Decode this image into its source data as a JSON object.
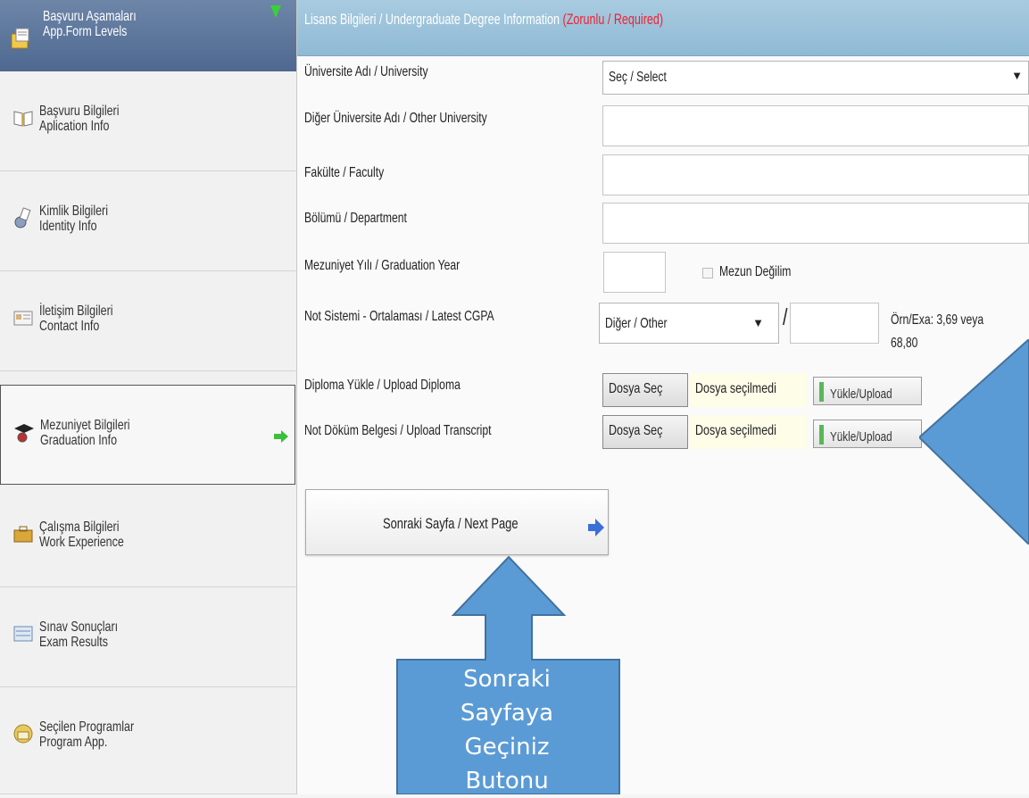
{
  "sidebar": {
    "header": {
      "line1": "Başvuru Aşamaları",
      "line2": "App.Form Levels"
    },
    "items": [
      {
        "line1": "Başvuru Bilgileri",
        "line2": "Aplication Info"
      },
      {
        "line1": "Kimlik Bilgileri",
        "line2": "Identity Info"
      },
      {
        "line1": "İletişim Bilgileri",
        "line2": "Contact Info"
      },
      {
        "line1": "Mezuniyet Bilgileri",
        "line2": "Graduation Info"
      },
      {
        "line1": "Çalışma Bilgileri",
        "line2": "Work Experience"
      },
      {
        "line1": "Sınav Sonuçları",
        "line2": "Exam Results"
      },
      {
        "line1": "Seçilen Programlar",
        "line2": "Program App."
      }
    ]
  },
  "section": {
    "title": "Lisans Bilgileri / Undergraduate Degree Information",
    "required": "(Zorunlu / Required)"
  },
  "form": {
    "university_label": "Üniversite Adı / University",
    "university_value": "Seç / Select",
    "other_university_label": "Diğer Üniversite Adı / Other University",
    "faculty_label": "Fakülte / Faculty",
    "department_label": "Bölümü / Department",
    "grad_year_label": "Mezuniyet Yılı / Graduation Year",
    "not_graduated_label": "Mezun Değilim",
    "grading_label": "Not Sistemi - Ortalaması / Latest CGPA",
    "grading_value": "Diğer / Other",
    "slash": "/",
    "example_line1": "Örn/Exa: 3,69 veya",
    "example_line2": "68,80",
    "diploma_label": "Diploma Yükle / Upload Diploma",
    "transcript_label": "Not Döküm Belgesi / Upload Transcript",
    "choose_file": "Dosya Seç",
    "no_file": "Dosya seçilmedi",
    "upload": "Yükle/Upload"
  },
  "next_button": "Sonraki Sayfa / Next Page",
  "callout": {
    "line1": "Sonraki",
    "line2": "Sayfaya",
    "line3": "Geçiniz",
    "line4": "Butonu"
  }
}
